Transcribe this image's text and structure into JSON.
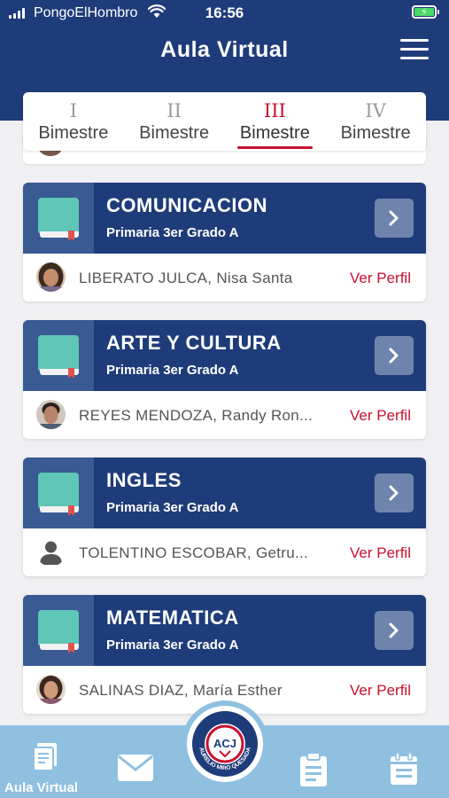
{
  "status_bar": {
    "carrier": "PongoElHombro",
    "time": "16:56"
  },
  "header": {
    "title": "Aula Virtual"
  },
  "tabs": [
    {
      "roman": "I",
      "label": "Bimestre",
      "active": false
    },
    {
      "roman": "II",
      "label": "Bimestre",
      "active": false
    },
    {
      "roman": "III",
      "label": "Bimestre",
      "active": true
    },
    {
      "roman": "IV",
      "label": "Bimestre",
      "active": false
    }
  ],
  "courses": [
    {
      "name": "COMUNICACION",
      "grade": "Primaria 3er Grado A",
      "teacher": "LIBERATO JULCA, Nisa Santa",
      "action": "Ver Perfil"
    },
    {
      "name": "ARTE Y CULTURA",
      "grade": "Primaria 3er Grado A",
      "teacher": "REYES MENDOZA, Randy Ron...",
      "action": "Ver Perfil"
    },
    {
      "name": "INGLES",
      "grade": "Primaria 3er Grado A",
      "teacher": "TOLENTINO ESCOBAR, Getru...",
      "action": "Ver Perfil"
    },
    {
      "name": "MATEMATICA",
      "grade": "Primaria 3er Grado A",
      "teacher": "SALINAS DIAZ, María Esther",
      "action": "Ver Perfil"
    }
  ],
  "bottom_nav": {
    "active_label": "Aula Virtual",
    "items": [
      "book-stack-icon",
      "mail-icon",
      "clipboard-icon",
      "calendar-icon"
    ]
  },
  "colors": {
    "primary": "#1f3c7a",
    "accent": "#c8102e",
    "nav_bg": "#8fc0e0",
    "book": "#5fc6b8"
  },
  "logo": {
    "top_text": "I.E.",
    "letters": "ACJ",
    "ring_text": "AURELIO MIRO QUESADA"
  }
}
